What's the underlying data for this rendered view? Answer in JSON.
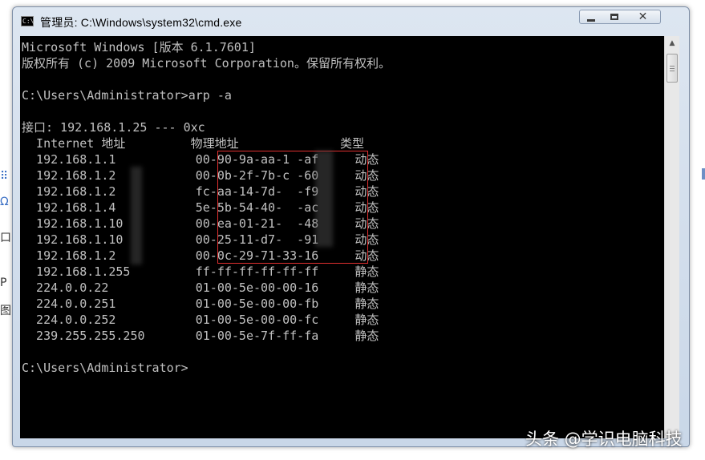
{
  "window": {
    "title": "管理员: C:\\Windows\\system32\\cmd.exe",
    "icon_text": "C:\\",
    "icon": "cmd-icon"
  },
  "controls": {
    "minimize": "minimize-icon",
    "maximize": "maximize-icon",
    "close": "close-icon"
  },
  "console": {
    "lines": [
      "Microsoft Windows [版本 6.1.7601]",
      "版权所有 (c) 2009 Microsoft Corporation。保留所有权利。",
      "",
      "C:\\Users\\Administrator>arp -a",
      "",
      "接口: 192.168.1.25 --- 0xc",
      "  Internet 地址         物理地址              类型",
      "  192.168.1.1           00-90-9a-aa-1 -af     动态",
      "  192.168.1.2           00-0b-2f-7b-c -60     动态",
      "  192.168.1.2           fc-aa-14-7d-  -f9     动态",
      "  192.168.1.4           5e-5b-54-40-  -ac     动态",
      "  192.168.1.10          00-ea-01-21-  -48     动态",
      "  192.168.1.10          00-25-11-d7-  -91     动态",
      "  192.168.1.2           00-0c-29-71-33-16     动态",
      "  192.168.1.255         ff-ff-ff-ff-ff-ff     静态",
      "  224.0.0.22            01-00-5e-00-00-16     静态",
      "  224.0.0.251           01-00-5e-00-00-fb     静态",
      "  224.0.0.252           01-00-5e-00-00-fc     静态",
      "  239.255.255.250       01-00-5e-7f-ff-fa     静态",
      "",
      "C:\\Users\\Administrator>"
    ]
  },
  "background_fragments": [
    "⠿",
    "Ω",
    "口",
    "P",
    "图"
  ],
  "watermark": "头条 @学识电脑科技",
  "colors": {
    "console_bg": "#000000",
    "console_fg": "#c0c0c0",
    "highlight": "#e03030"
  }
}
